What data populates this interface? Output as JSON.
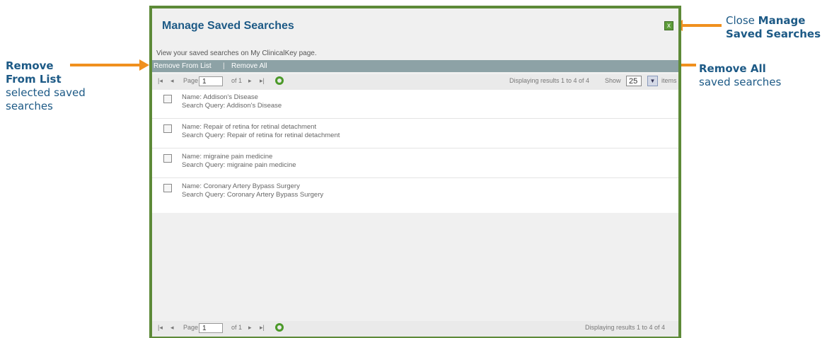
{
  "annotations": {
    "close": {
      "line1_normal": "Close ",
      "line1_bold": "Manage",
      "line2_bold": "Saved Searches"
    },
    "remove_from_list": {
      "line1_bold": "Remove",
      "line2_bold": "From List",
      "line3": "selected saved",
      "line4": "searches"
    },
    "remove_all": {
      "line1_bold": "Remove All",
      "line2": "saved searches"
    }
  },
  "dialog": {
    "title": "Manage Saved Searches",
    "close_label": "x",
    "description": "View your saved searches on My ClinicalKey page.",
    "toolbar": {
      "remove_from_list": "Remove From List",
      "separator": "|",
      "remove_all": "Remove All"
    }
  },
  "pager_top": {
    "page_label": "Page",
    "page_value": "1",
    "of_label": "of 1",
    "display_text": "Displaying results 1 to 4 of 4",
    "show_label": "Show",
    "show_value": "25",
    "items_label": "items"
  },
  "results": [
    {
      "name": "Name: Addison's Disease",
      "query": "Search Query: Addison's Disease"
    },
    {
      "name": "Name: Repair of retina for retinal detachment",
      "query": "Search Query: Repair of retina for retinal detachment"
    },
    {
      "name": "Name: migraine pain medicine",
      "query": "Search Query: migraine pain medicine"
    },
    {
      "name": "Name: Coronary Artery Bypass Surgery",
      "query": "Search Query: Coronary Artery Bypass Surgery"
    }
  ],
  "pager_bottom": {
    "page_label": "Page",
    "page_value": "1",
    "of_label": "of 1",
    "display_text": "Displaying results 1 to 4 of 4"
  },
  "colors": {
    "accent_orange": "#f0901e",
    "border_green": "#5d8a38",
    "title_blue": "#1d5a86",
    "toolbar_gray": "#8da2a6"
  }
}
